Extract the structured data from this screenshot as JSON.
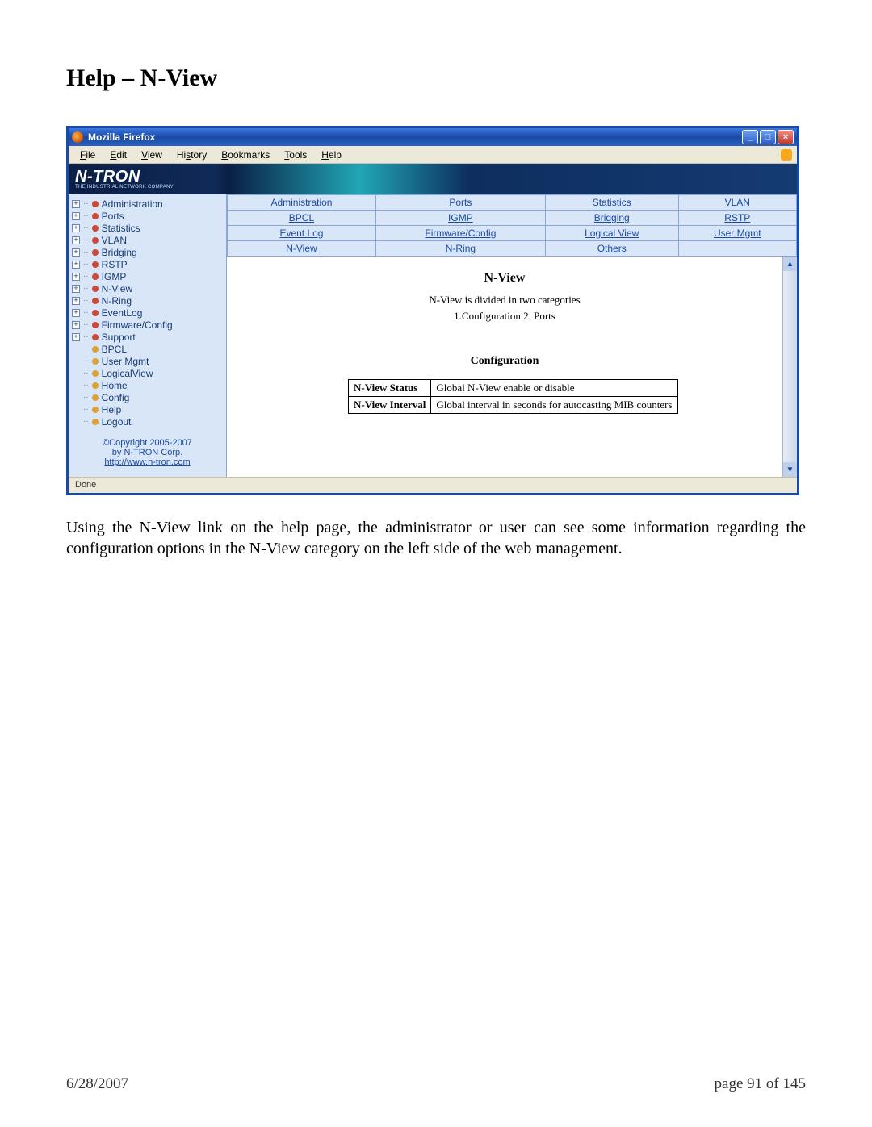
{
  "doc": {
    "title": "Help – N-View",
    "paragraph": "Using the N-View link on the help page, the administrator or user can see some information regarding the configuration options in the N-View category on the left side of the web management.",
    "date": "6/28/2007",
    "page": "page 91 of 145"
  },
  "window": {
    "title": "Mozilla Firefox",
    "menus": [
      "File",
      "Edit",
      "View",
      "History",
      "Bookmarks",
      "Tools",
      "Help"
    ],
    "status": "Done"
  },
  "logo": {
    "name": "N-TRON",
    "tag": "THE INDUSTRIAL NETWORK COMPANY"
  },
  "tree": {
    "expand": [
      "Administration",
      "Ports",
      "Statistics",
      "VLAN",
      "Bridging",
      "RSTP",
      "IGMP",
      "N-View",
      "N-Ring",
      "EventLog",
      "Firmware/Config",
      "Support"
    ],
    "leaf": [
      "BPCL",
      "User Mgmt",
      "LogicalView",
      "Home",
      "Config",
      "Help",
      "Logout"
    ]
  },
  "copy": {
    "line1": "©Copyright 2005-2007",
    "line2": "by N-TRON Corp.",
    "link": "http://www.n-tron.com"
  },
  "grid": {
    "r1": [
      "Administration",
      "Ports",
      "Statistics",
      "VLAN"
    ],
    "r2": [
      "BPCL",
      "IGMP",
      "Bridging",
      "RSTP"
    ],
    "r3": [
      "Event Log",
      "Firmware/Config",
      "Logical View",
      "User Mgmt"
    ],
    "r4": [
      "N-View",
      "N-Ring",
      "Others",
      ""
    ]
  },
  "content": {
    "heading": "N-View",
    "intro1": "N-View is divided in two categories",
    "intro2": "1.Configuration   2. Ports",
    "section": "Configuration",
    "table": {
      "r1k": "N-View Status",
      "r1v": "Global N-View enable or disable",
      "r2k": "N-View Interval",
      "r2v": "Global interval in seconds for autocasting MIB counters"
    }
  }
}
